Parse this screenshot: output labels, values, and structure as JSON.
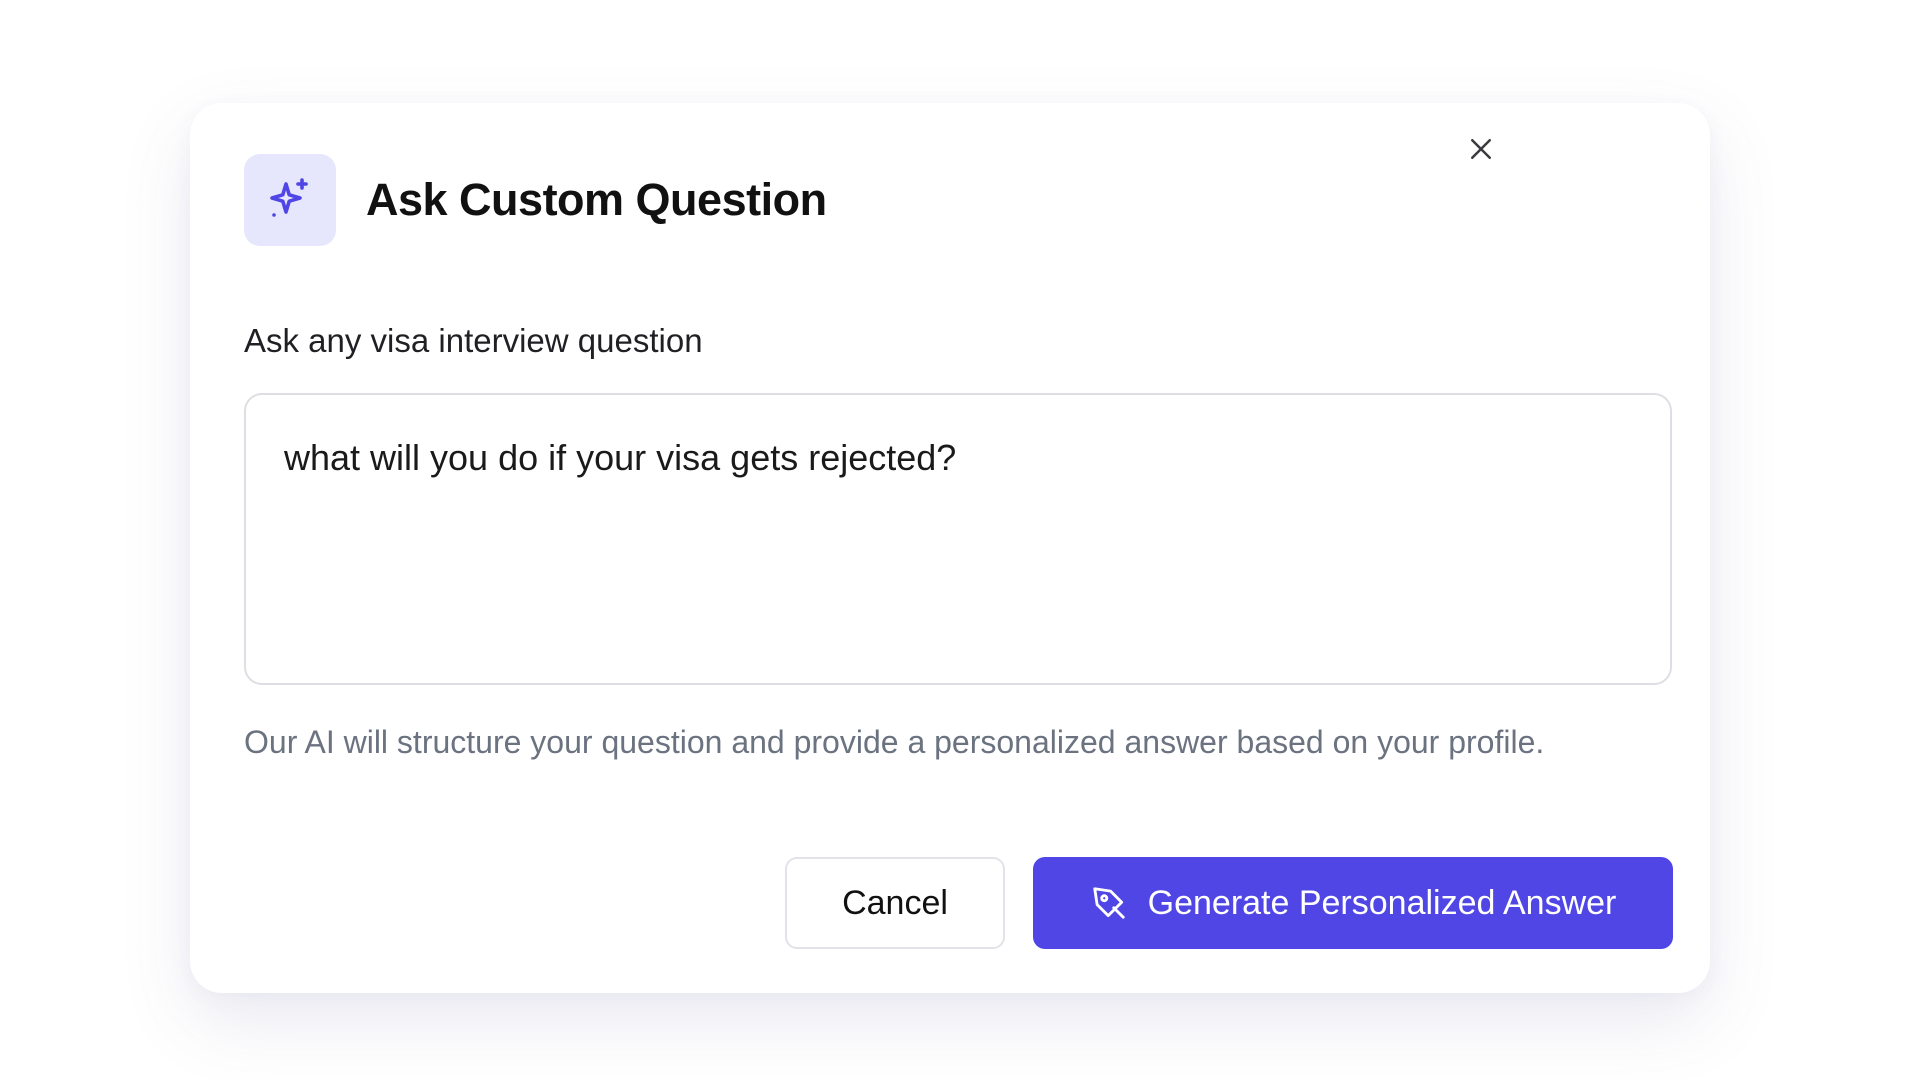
{
  "dialog": {
    "title": "Ask Custom Question",
    "title_icon": "sparkles-icon",
    "close_icon": "close-icon",
    "field": {
      "label": "Ask any visa interview question",
      "value": "what will you do if your visa gets rejected?"
    },
    "helper_text": "Our AI will structure your question and provide a personalized answer based on your profile.",
    "actions": {
      "cancel_label": "Cancel",
      "generate_label": "Generate Personalized Answer",
      "generate_icon": "pen-tool-icon"
    }
  },
  "colors": {
    "primary": "#4f46e5",
    "icon_bg": "#e6e7fd",
    "helper_text": "#6b7280",
    "border": "#dedfe4"
  }
}
